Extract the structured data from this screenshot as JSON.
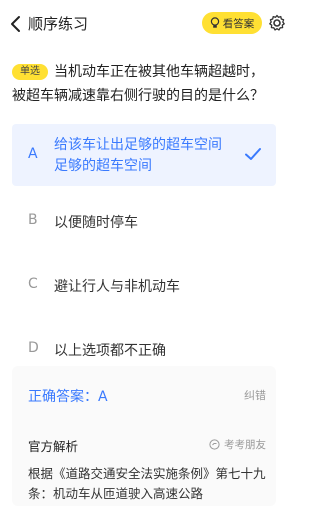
{
  "header": {
    "title": "顺序练习",
    "answer_button": "看答案"
  },
  "question": {
    "type_tag": "单选",
    "text": "当机动车正在被其他车辆超越时，被超车辆减速靠右侧行驶的目的是什么？"
  },
  "options": [
    {
      "letter": "A",
      "line1": "给该车让出足够的超车空间",
      "line2": "足够的超车空间",
      "selected": true
    },
    {
      "letter": "B",
      "text": "以便随时停车"
    },
    {
      "letter": "C",
      "text": "避让行人与非机动车"
    },
    {
      "letter": "D",
      "text": "以上选项都不正确"
    }
  ],
  "result": {
    "correct_answer_label": "正确答案：A",
    "report_label": "纠错"
  },
  "analysis": {
    "title": "官方解析",
    "source_label": "考考朋友",
    "text": "根据《道路交通安全法实施条例》第七十九条：机动车从匝道驶入高速公路"
  },
  "colors": {
    "accent": "#3A7AFE",
    "yellow": "#FFE033",
    "selected_bg": "#EEF3FF"
  }
}
